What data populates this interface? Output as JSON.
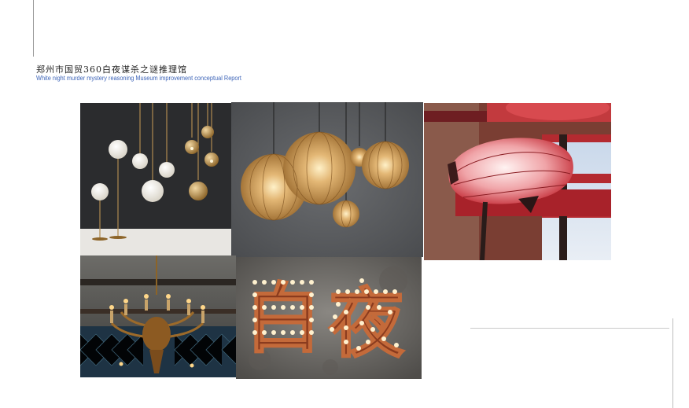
{
  "header": {
    "title_zh": "郑州市国贸360白夜谋杀之谜推理馆",
    "title_en": "White night murder mystery reasoning Museum improvement conceptual Report"
  },
  "moodboard": {
    "sign": {
      "chars": [
        "白",
        "夜"
      ]
    }
  },
  "colors": {
    "accent_blue": "#3d64b8",
    "lantern_red": "#c5303a",
    "brass": "#b98a45"
  }
}
